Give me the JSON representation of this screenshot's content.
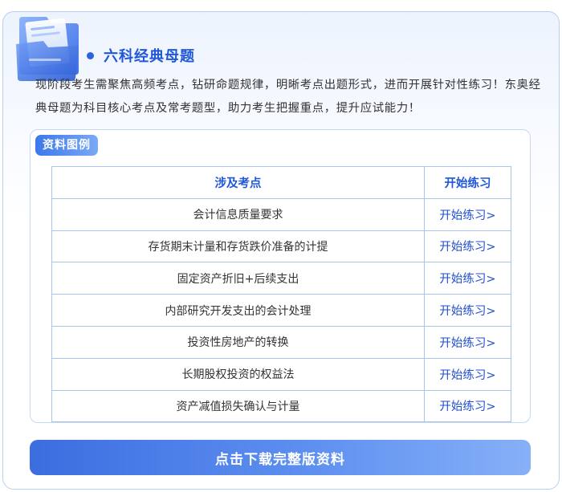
{
  "header": {
    "title": "六科经典母题",
    "icon": "folder-icon"
  },
  "intro": {
    "text": "现阶段考生需聚焦高频考点，钻研命题规律，明晰考点出题形式，进而开展针对性练习！东奥经典母题为科目核心考点及常考题型，助力考生把握重点，提升应试能力！"
  },
  "panel": {
    "tag": "资料图例"
  },
  "table": {
    "headers": [
      "涉及考点",
      "开始练习"
    ],
    "rows": [
      {
        "topic": "会计信息质量要求",
        "action": "开始练习>"
      },
      {
        "topic": "存货期末计量和存货跌价准备的计提",
        "action": "开始练习>"
      },
      {
        "topic": "固定资产折旧+后续支出",
        "action": "开始练习>"
      },
      {
        "topic": "内部研究开发支出的会计处理",
        "action": "开始练习>"
      },
      {
        "topic": "投资性房地产的转换",
        "action": "开始练习>"
      },
      {
        "topic": "长期股权投资的权益法",
        "action": "开始练习>"
      },
      {
        "topic": "资产减值损失确认与计量",
        "action": "开始练习>"
      }
    ]
  },
  "footer": {
    "download_label": "点击下载完整版资料"
  },
  "colors": {
    "accent": "#1f57d8",
    "border": "#a9c3ea",
    "button_start": "#3c6de0",
    "button_end": "#86b0f7"
  }
}
